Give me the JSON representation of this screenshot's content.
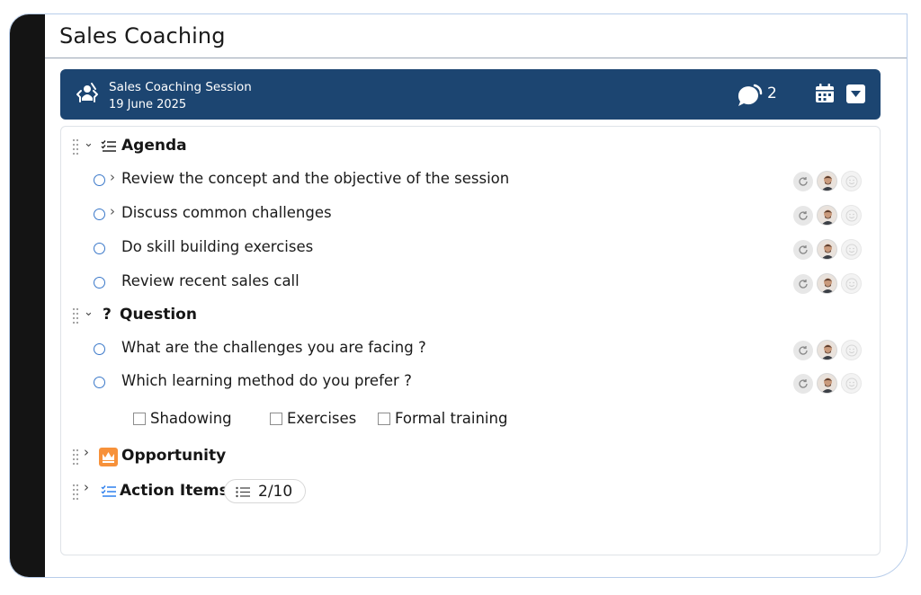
{
  "page": {
    "title": "Sales Coaching"
  },
  "header": {
    "session_title": "Sales Coaching Session",
    "session_date": "19 June 2025",
    "comment_count": "2",
    "icons": [
      "coaching-icon",
      "chat-icon",
      "calendar-icon",
      "dropdown-icon"
    ],
    "colors": {
      "header_bg": "#1c4571",
      "item_circle": "#3a78c9",
      "opportunity_badge": "#f7913a",
      "action_icon": "#2f80ed"
    }
  },
  "sections": {
    "agenda": {
      "title": "Agenda",
      "items": [
        {
          "text": "Review the concept and the objective of the session",
          "expandable": true
        },
        {
          "text": "Discuss common challenges",
          "expandable": true
        },
        {
          "text": "Do skill building exercises",
          "expandable": false
        },
        {
          "text": "Review recent sales call",
          "expandable": false
        }
      ]
    },
    "question": {
      "icon_glyph": "?",
      "title": "Question",
      "items": [
        {
          "text": "What are the challenges you are facing ?"
        },
        {
          "text": "Which learning method do you prefer ?"
        }
      ],
      "options": [
        "Shadowing",
        "Exercises",
        "Formal training"
      ]
    },
    "opportunity": {
      "title": "Opportunity"
    },
    "action_items": {
      "title": "Action Items",
      "count": "2/10"
    }
  }
}
